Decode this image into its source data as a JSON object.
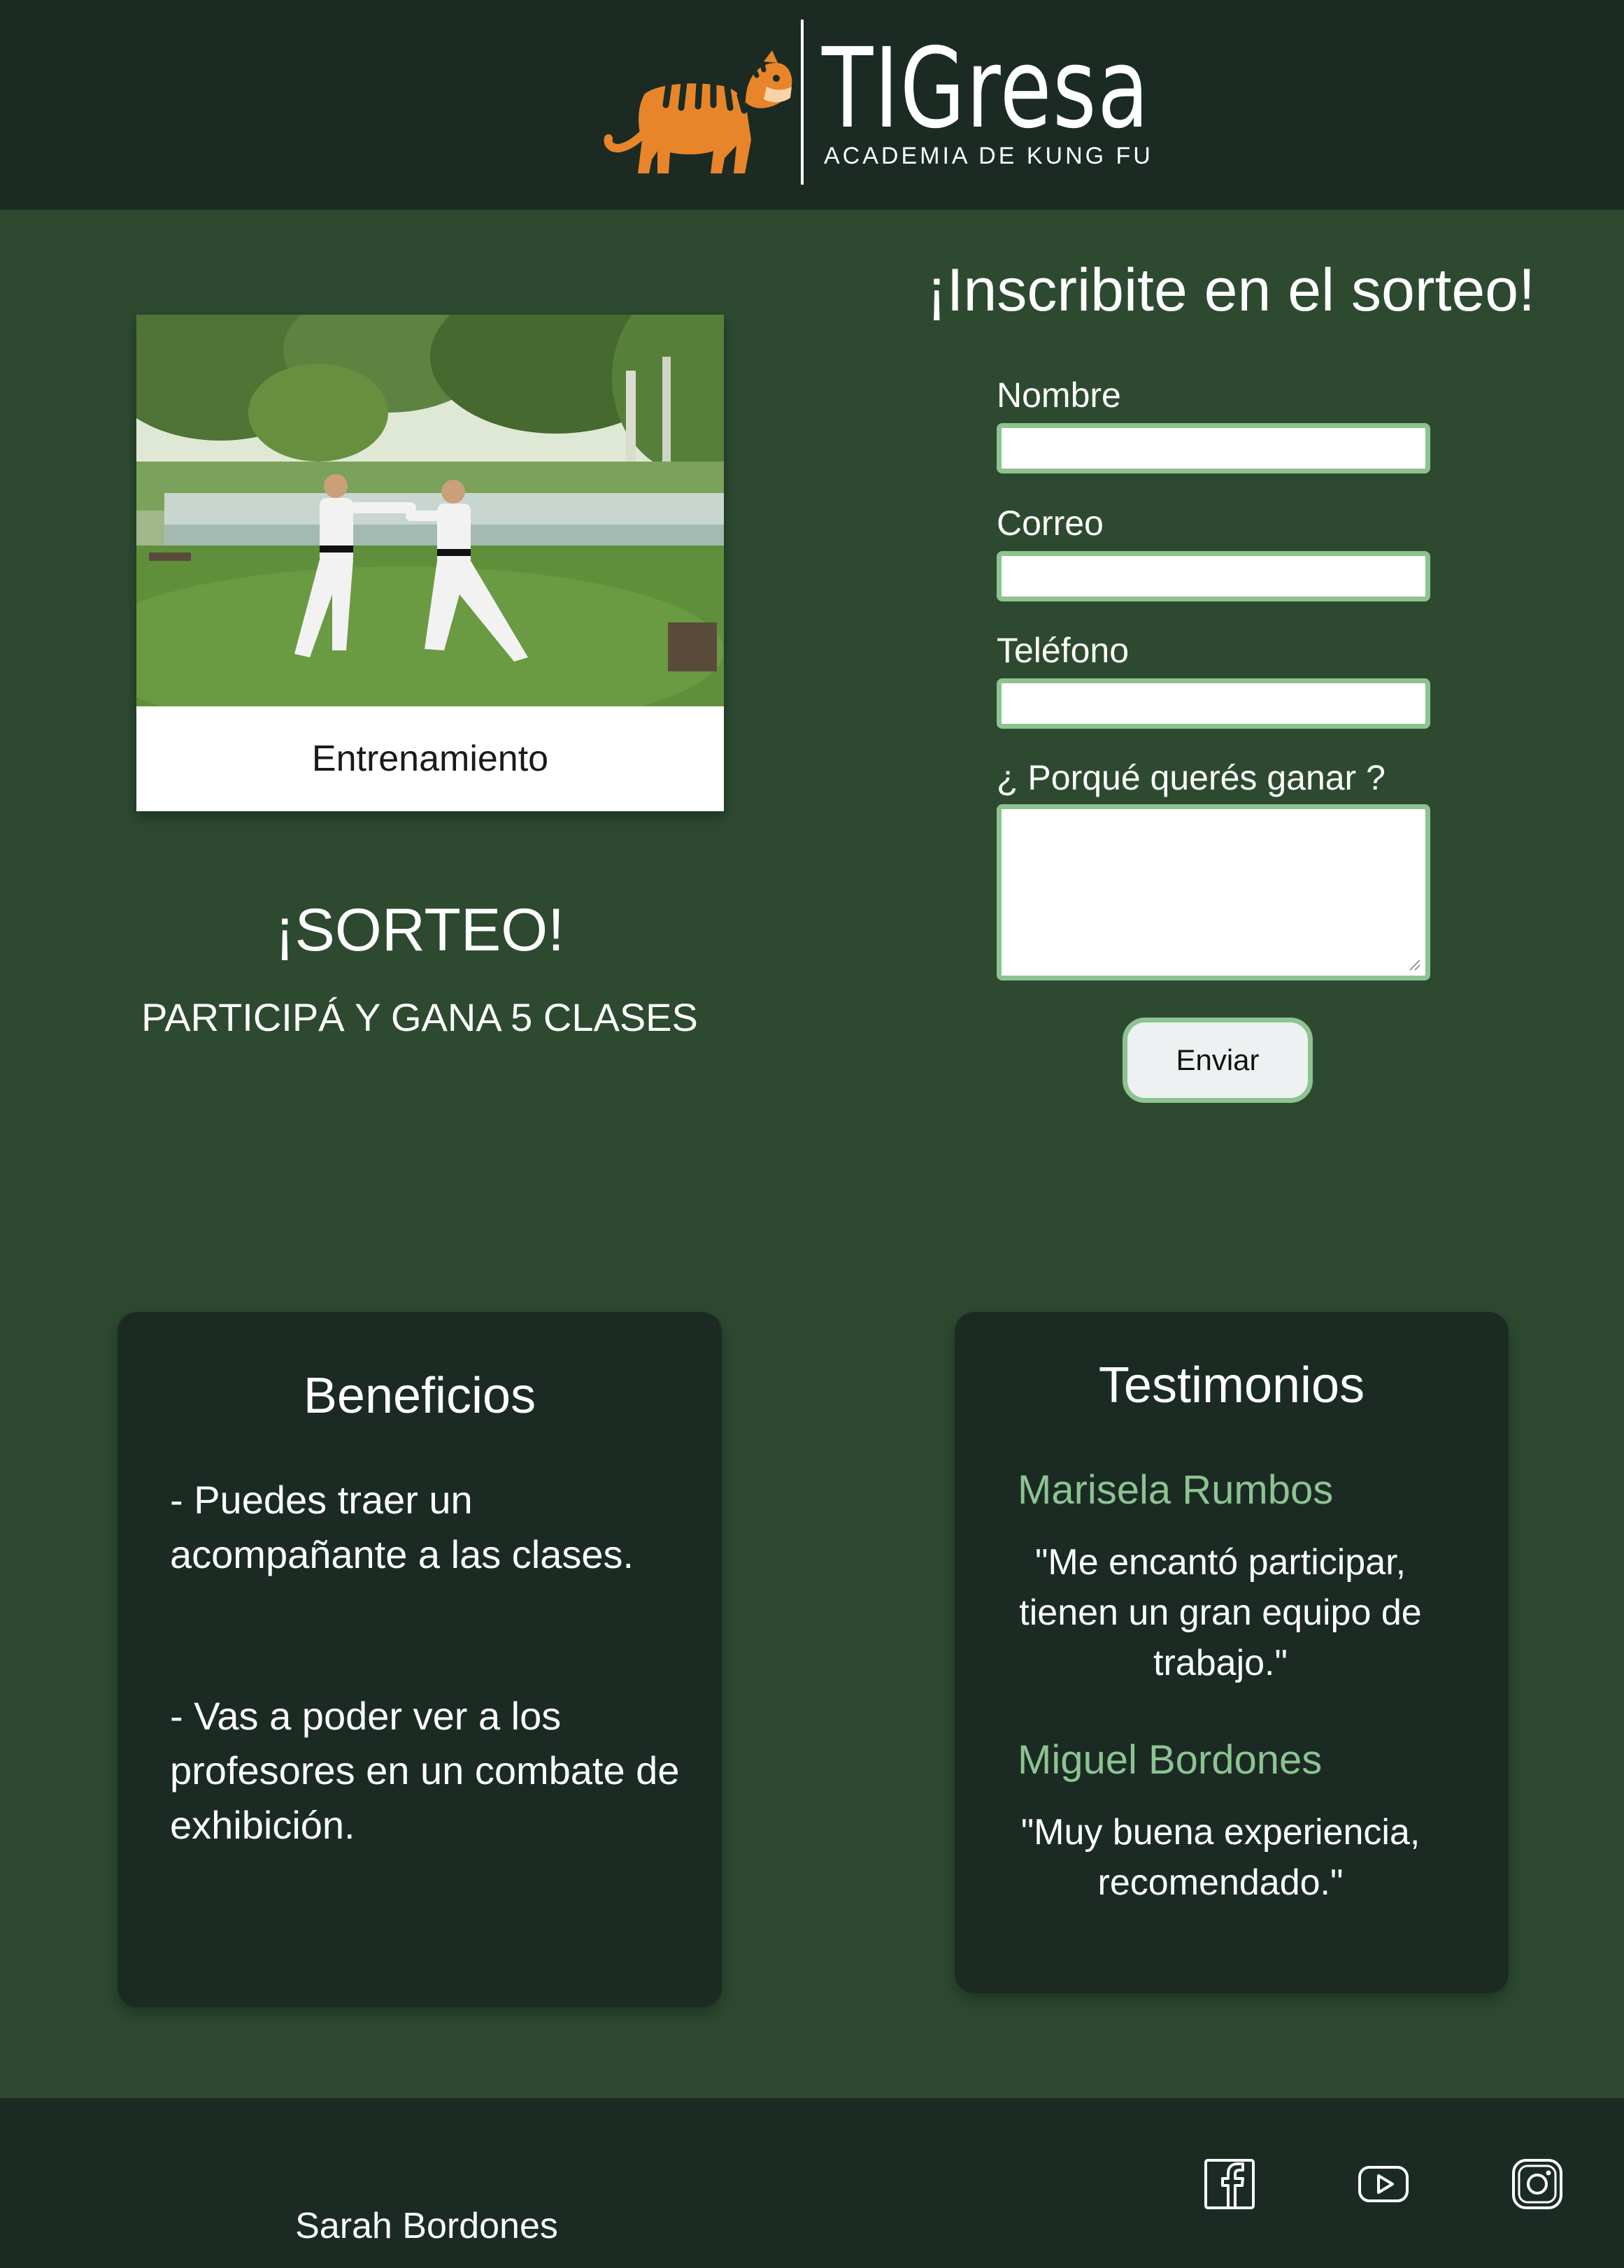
{
  "header": {
    "brand_name": "TIGresa",
    "tagline": "ACADEMIA DE KUNG FU",
    "logo_icon": "tiger-icon"
  },
  "photo_card": {
    "image": "two martial artists in white gi and black belts sparring on grass by a lake",
    "caption": "Entrenamiento"
  },
  "promo": {
    "title": "¡SORTEO!",
    "subtitle": "PARTICIPÁ Y GANA 5 CLASES"
  },
  "form": {
    "title": "¡Inscribite en el sorteo!",
    "name_label": "Nombre",
    "name_value": "",
    "email_label": "Correo",
    "email_value": "",
    "phone_label": "Teléfono",
    "phone_value": "",
    "reason_label": "¿ Porqué querés ganar ?",
    "reason_value": "",
    "submit_label": "Enviar"
  },
  "benefits": {
    "title": "Beneficios",
    "items": [
      "- Puedes traer un acompañante a las clases.",
      "- Vas a poder ver a los profesores en un combate de exhibición."
    ]
  },
  "testimonials": {
    "title": "Testimonios",
    "items": [
      {
        "author": "Marisela Rumbos",
        "quote": "\"Me encantó participar, tienen un gran equipo de trabajo.\""
      },
      {
        "author": "Miguel Bordones",
        "quote": "\"Muy buena experiencia, recomendado.\""
      }
    ]
  },
  "footer": {
    "name": "Sarah Bordones",
    "social_icons": [
      "facebook-icon",
      "youtube-icon",
      "instagram-icon"
    ]
  },
  "colors": {
    "background": "#2d4a31",
    "dark": "#1b2b24",
    "accent": "#8dc391",
    "tiger_orange": "#e8852a",
    "text": "#ffffff"
  }
}
